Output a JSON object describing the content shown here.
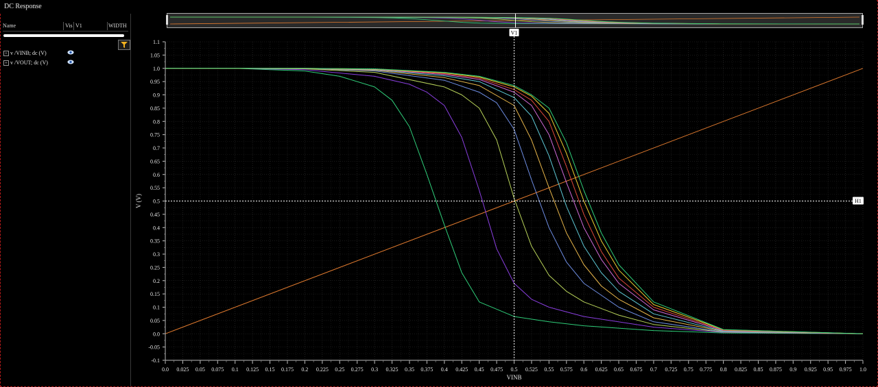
{
  "window": {
    "title": "DC Response"
  },
  "trace_panel": {
    "columns": [
      "Name",
      "Vis",
      "V1",
      "WIDTH"
    ],
    "traces": [
      {
        "label": "v /VINB; dc (V)",
        "icon": "eye-icon",
        "visible": true
      },
      {
        "label": "v /VOUT; dc (V)",
        "icon": "eye-icon",
        "visible": true
      }
    ],
    "filter_icon": "filter-icon"
  },
  "colors": {
    "background": "#000000",
    "grid": "#333333",
    "vinb": "#e07a2e",
    "marker": "#ffffff",
    "vout_series": [
      "#2fcf7a",
      "#8a3fe0",
      "#b9d45a",
      "#6f8fe6",
      "#e8b64a",
      "#5ec9d6",
      "#d06ad8",
      "#e04a3a",
      "#f0d030"
    ]
  },
  "chart_data": {
    "type": "line",
    "xlabel": "VINB",
    "ylabel": "V (V)",
    "xlim": [
      0.0,
      1.0
    ],
    "ylim": [
      -0.1,
      1.1
    ],
    "x_ticks": [
      "0.0",
      "0.025",
      "0.05",
      "0.075",
      "0.1",
      "0.125",
      "0.15",
      "0.175",
      "0.2",
      "0.225",
      "0.25",
      "0.275",
      "0.3",
      "0.325",
      "0.35",
      "0.375",
      "0.4",
      "0.425",
      "0.45",
      "0.475",
      "0.5",
      "0.525",
      "0.55",
      "0.575",
      "0.6",
      "0.625",
      "0.65",
      "0.675",
      "0.7",
      "0.725",
      "0.75",
      "0.775",
      "0.8",
      "0.825",
      "0.85",
      "0.875",
      "0.9",
      "0.925",
      "0.95",
      "0.975",
      "1.0"
    ],
    "y_ticks": [
      "1.1",
      "1.05",
      "1.0",
      "0.95",
      "0.9",
      "0.85",
      "0.8",
      "0.75",
      "0.7",
      "0.65",
      "0.6",
      "0.55",
      "0.5",
      "0.45",
      "0.4",
      "0.35",
      "0.3",
      "0.25",
      "0.2",
      "0.15",
      "0.1",
      "0.05",
      "0.0",
      "-0.05",
      "-0.1"
    ],
    "grid": true,
    "markers": {
      "vertical": {
        "name": "V1",
        "x": 0.5
      },
      "horizontal": {
        "name": "H1",
        "y": 0.5
      }
    },
    "series": [
      {
        "name": "v /VINB; dc (V)",
        "x": [
          0.0,
          1.0
        ],
        "values": [
          0.0,
          1.0
        ]
      },
      {
        "x": [
          0.0,
          0.1,
          0.2,
          0.25,
          0.3,
          0.325,
          0.35,
          0.375,
          0.4,
          0.425,
          0.45,
          0.5,
          0.55,
          0.6,
          0.7,
          0.8,
          1.0
        ],
        "values": [
          1.0,
          1.0,
          0.99,
          0.97,
          0.93,
          0.88,
          0.78,
          0.6,
          0.41,
          0.23,
          0.12,
          0.065,
          0.045,
          0.03,
          0.012,
          0.003,
          0.0
        ]
      },
      {
        "x": [
          0.0,
          0.1,
          0.2,
          0.3,
          0.35,
          0.375,
          0.4,
          0.425,
          0.45,
          0.475,
          0.5,
          0.525,
          0.55,
          0.6,
          0.7,
          0.8,
          1.0
        ],
        "values": [
          1.0,
          1.0,
          0.995,
          0.97,
          0.94,
          0.91,
          0.86,
          0.74,
          0.54,
          0.32,
          0.19,
          0.13,
          0.1,
          0.065,
          0.025,
          0.005,
          0.0
        ]
      },
      {
        "x": [
          0.0,
          0.1,
          0.2,
          0.3,
          0.4,
          0.425,
          0.45,
          0.475,
          0.5,
          0.525,
          0.55,
          0.575,
          0.6,
          0.65,
          0.7,
          0.8,
          1.0
        ],
        "values": [
          1.0,
          1.0,
          0.998,
          0.985,
          0.93,
          0.9,
          0.85,
          0.73,
          0.51,
          0.33,
          0.22,
          0.16,
          0.12,
          0.07,
          0.035,
          0.006,
          0.0
        ]
      },
      {
        "x": [
          0.0,
          0.1,
          0.2,
          0.3,
          0.4,
          0.45,
          0.475,
          0.5,
          0.525,
          0.55,
          0.575,
          0.6,
          0.65,
          0.7,
          0.8,
          1.0
        ],
        "values": [
          1.0,
          1.0,
          0.999,
          0.99,
          0.955,
          0.91,
          0.87,
          0.77,
          0.58,
          0.4,
          0.27,
          0.19,
          0.1,
          0.045,
          0.007,
          0.0
        ]
      },
      {
        "x": [
          0.0,
          0.1,
          0.2,
          0.3,
          0.4,
          0.45,
          0.5,
          0.525,
          0.55,
          0.575,
          0.6,
          0.625,
          0.65,
          0.7,
          0.8,
          1.0
        ],
        "values": [
          1.0,
          1.0,
          0.999,
          0.993,
          0.965,
          0.935,
          0.86,
          0.73,
          0.55,
          0.38,
          0.26,
          0.18,
          0.13,
          0.06,
          0.009,
          0.0
        ]
      },
      {
        "x": [
          0.0,
          0.1,
          0.2,
          0.3,
          0.4,
          0.45,
          0.5,
          0.525,
          0.55,
          0.575,
          0.6,
          0.625,
          0.65,
          0.7,
          0.8,
          1.0
        ],
        "values": [
          1.0,
          1.0,
          1.0,
          0.995,
          0.972,
          0.95,
          0.89,
          0.82,
          0.67,
          0.48,
          0.33,
          0.23,
          0.16,
          0.075,
          0.01,
          0.0
        ]
      },
      {
        "x": [
          0.0,
          0.1,
          0.2,
          0.3,
          0.4,
          0.45,
          0.5,
          0.525,
          0.55,
          0.575,
          0.6,
          0.625,
          0.65,
          0.7,
          0.8,
          1.0
        ],
        "values": [
          1.0,
          1.0,
          1.0,
          0.996,
          0.977,
          0.958,
          0.91,
          0.86,
          0.75,
          0.57,
          0.4,
          0.28,
          0.19,
          0.09,
          0.012,
          0.0
        ]
      },
      {
        "x": [
          0.0,
          0.1,
          0.2,
          0.3,
          0.4,
          0.45,
          0.5,
          0.525,
          0.55,
          0.575,
          0.6,
          0.625,
          0.65,
          0.7,
          0.8,
          1.0
        ],
        "values": [
          1.0,
          1.0,
          1.0,
          0.997,
          0.98,
          0.963,
          0.92,
          0.88,
          0.8,
          0.63,
          0.45,
          0.31,
          0.21,
          0.1,
          0.013,
          0.0
        ]
      },
      {
        "x": [
          0.0,
          0.1,
          0.2,
          0.3,
          0.4,
          0.45,
          0.5,
          0.525,
          0.55,
          0.575,
          0.6,
          0.625,
          0.65,
          0.7,
          0.8,
          1.0
        ],
        "values": [
          1.0,
          1.0,
          1.0,
          0.997,
          0.983,
          0.967,
          0.93,
          0.895,
          0.83,
          0.68,
          0.5,
          0.35,
          0.24,
          0.11,
          0.015,
          0.0
        ]
      },
      {
        "x": [
          0.0,
          0.1,
          0.2,
          0.3,
          0.4,
          0.45,
          0.5,
          0.525,
          0.55,
          0.575,
          0.6,
          0.625,
          0.65,
          0.7,
          0.8,
          1.0
        ],
        "values": [
          1.0,
          1.0,
          1.0,
          0.998,
          0.985,
          0.97,
          0.935,
          0.9,
          0.85,
          0.72,
          0.54,
          0.38,
          0.26,
          0.12,
          0.016,
          0.0
        ]
      }
    ]
  }
}
